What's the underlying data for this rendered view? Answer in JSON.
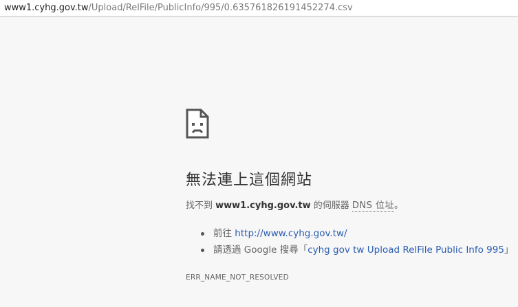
{
  "address_bar": {
    "host": "www1.cyhg.gov.tw",
    "path": "/Upload/RelFile/PublicInfo/995/0.635761826191452274.csv"
  },
  "error": {
    "icon": "sad-page-icon",
    "title": "無法連上這個網站",
    "explanation_prefix": "找不到 ",
    "explanation_host": "www1.cyhg.gov.tw",
    "explanation_middle": " 的伺服器 ",
    "explanation_dns": "DNS 位址",
    "explanation_suffix": "。",
    "suggestions": [
      {
        "prefix": "前往 ",
        "link": "http://www.cyhg.gov.tw/"
      },
      {
        "prefix": "請透過 Google 搜尋「",
        "link": "cyhg gov tw Upload RelFile Public Info 995",
        "suffix": "」"
      }
    ],
    "code": "ERR_NAME_NOT_RESOLVED"
  },
  "colors": {
    "background": "#f7f7f7",
    "link": "#2a5db0",
    "text": "#646464",
    "title": "#333333"
  }
}
